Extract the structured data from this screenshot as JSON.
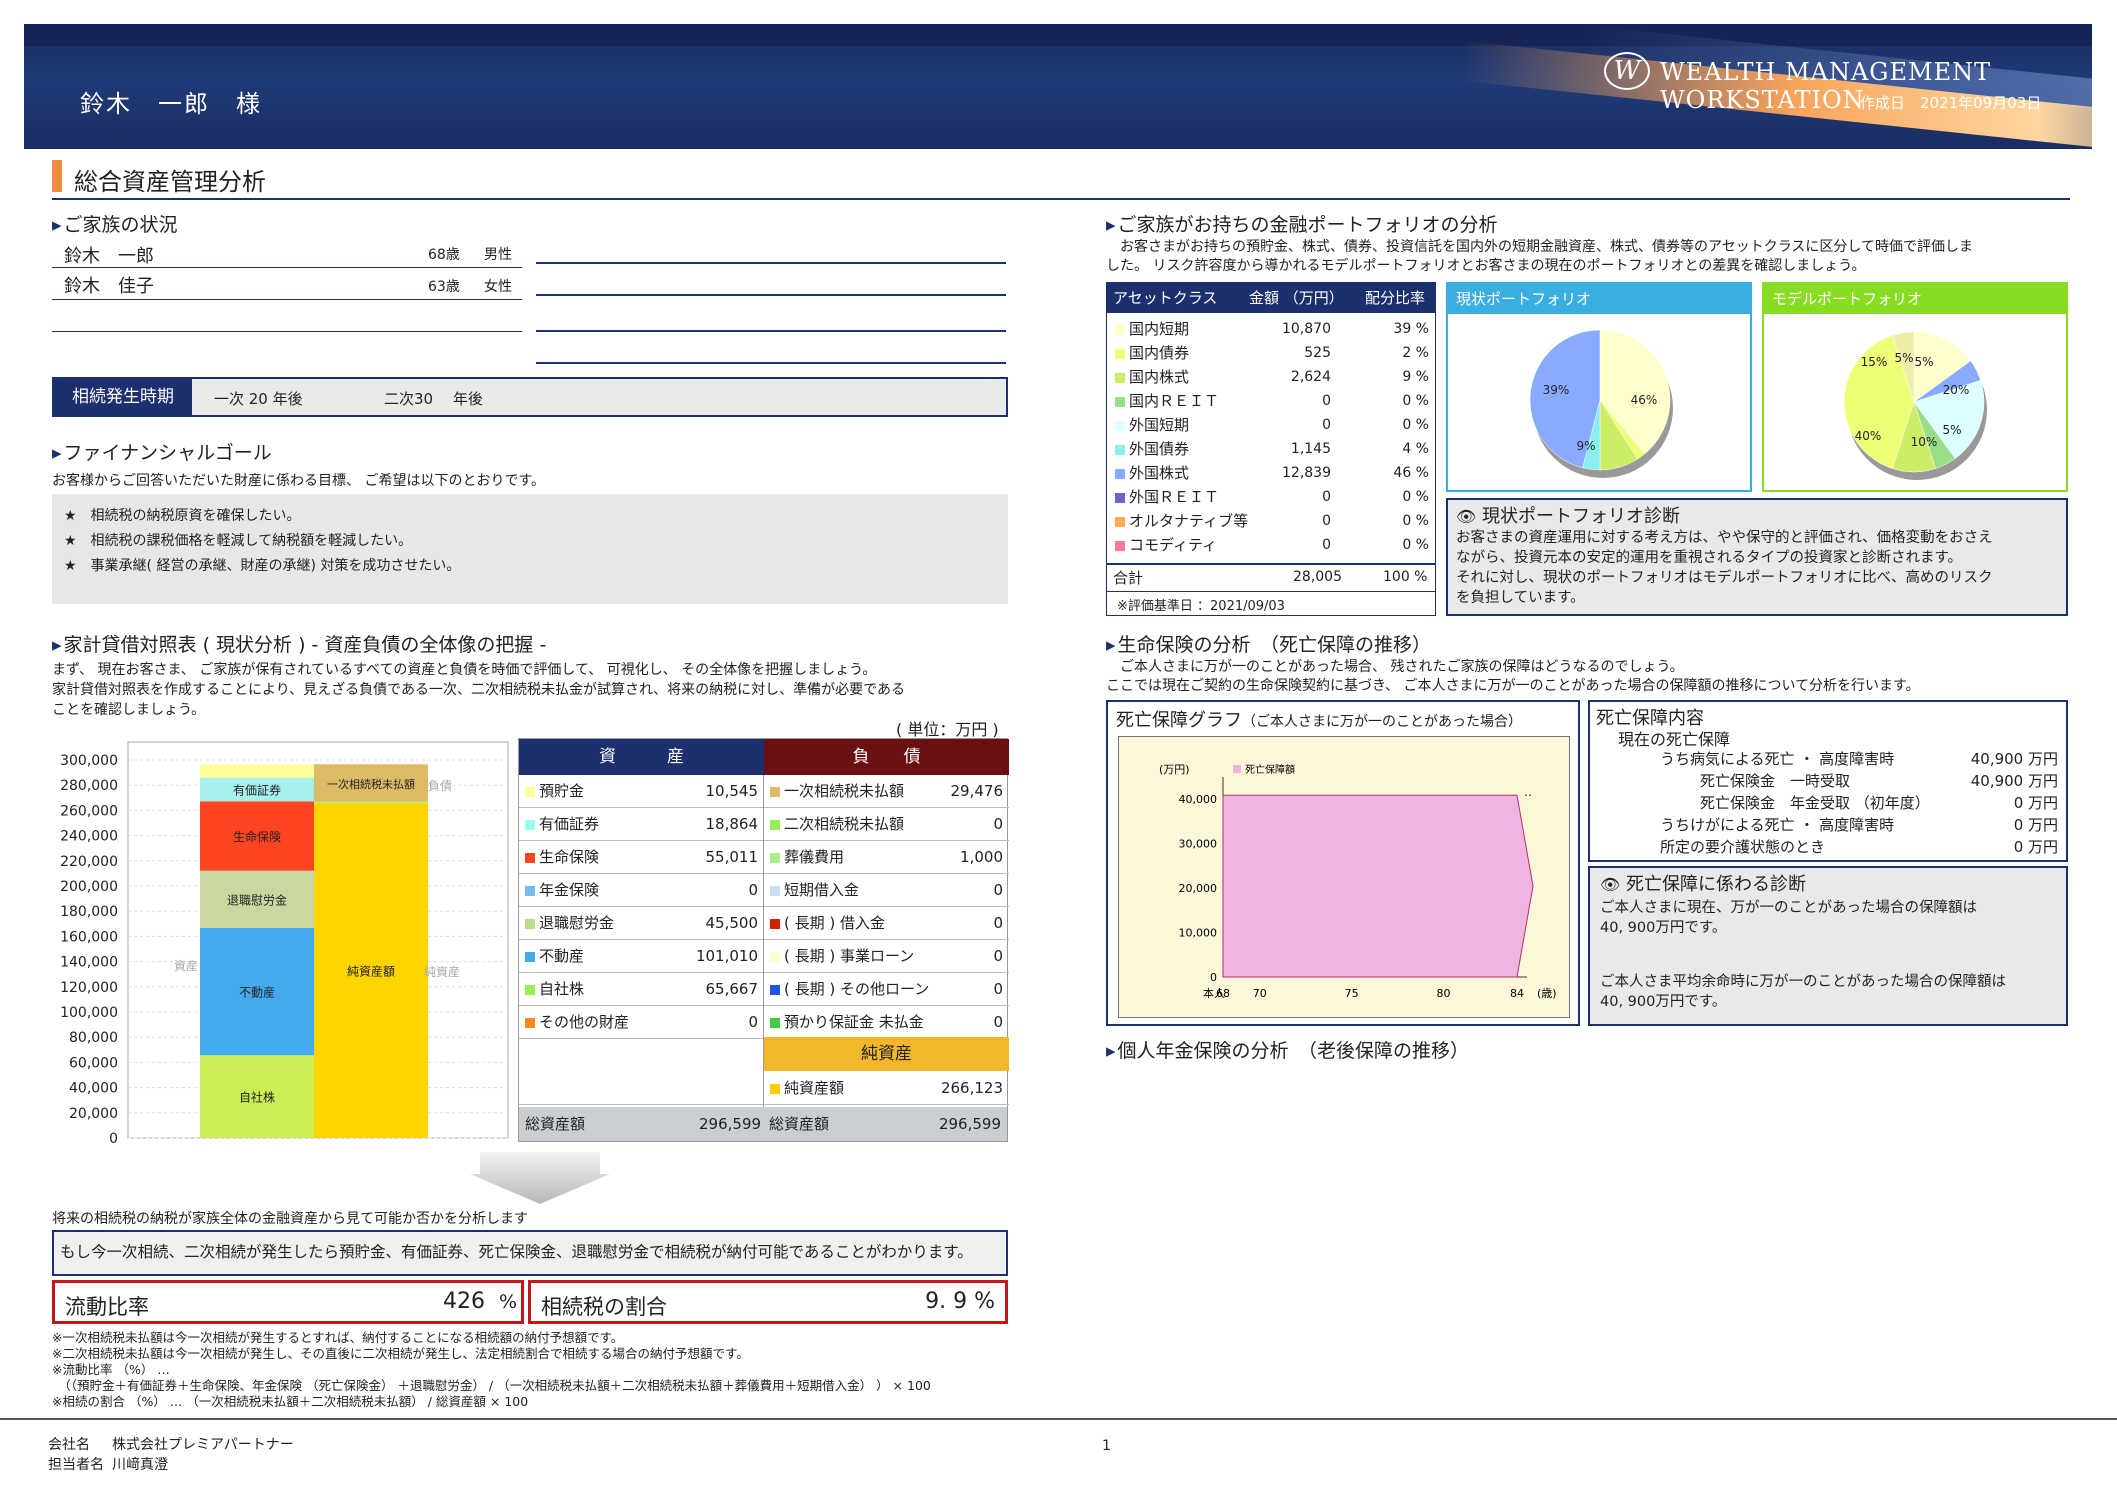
{
  "header": {
    "customer_name": "鈴木　一郎　様",
    "logo_letter": "W",
    "logo_text": "WEALTH MANAGEMENT WORKSTATION",
    "created_date": "作成日　2021年09月03日"
  },
  "page_title": "総合資産管理分析",
  "family": {
    "title": "ご家族の状況",
    "members": [
      {
        "name": "鈴木　一郎",
        "age": "68歳",
        "gender": "男性"
      },
      {
        "name": "鈴木　佳子",
        "age": "63歳",
        "gender": "女性"
      }
    ],
    "inheritance_label": "相続発生時期",
    "inheritance_first": "一次  20  年後",
    "inheritance_second": "二次30　 年後"
  },
  "goals": {
    "title": "ファイナンシャルゴール",
    "intro": "お客様からご回答いただいた財産に係わる目標、 ご希望は以下のとおりです。",
    "items": [
      "★　相続税の納税原資を確保したい。",
      "★　相続税の課税価格を軽減して納税額を軽減したい。",
      "★　事業承継( 経営の承継、財産の承継) 対策を成功させたい。"
    ]
  },
  "balance": {
    "title": "家計貸借対照表 ( 現状分析 )  - 資産負債の全体像の把握 -",
    "intro": "まず、 現在お客さま、 ご家族が保有されているすべての資産と負債を時価で評価して、 可視化し、 その全体像を把握しましょう。\n家計貸借対照表を作成することにより、見えざる負債である一次、二次相続税未払金が試算され、将来の納税に対し、準備が必要である\nことを確認しましょう。",
    "unit": "( 単位：万円 )",
    "assets_header": "資　　　産",
    "liab_header": "負　　債",
    "assets": [
      {
        "label": "預貯金",
        "value": "10,545",
        "color": "#ffff99"
      },
      {
        "label": "有価証券",
        "value": "18,864",
        "color": "#99ffee"
      },
      {
        "label": "生命保険",
        "value": "55,011",
        "color": "#ff4422"
      },
      {
        "label": "年金保険",
        "value": "0",
        "color": "#77bbee"
      },
      {
        "label": "退職慰労金",
        "value": "45,500",
        "color": "#bbdd88"
      },
      {
        "label": "不動産",
        "value": "101,010",
        "color": "#44aaee"
      },
      {
        "label": "自社株",
        "value": "65,667",
        "color": "#99ee55"
      },
      {
        "label": "その他の財産",
        "value": "0",
        "color": "#ff8822"
      }
    ],
    "liabilities": [
      {
        "label": "一次相続税未払額",
        "value": "29,476",
        "color": "#ddbb66"
      },
      {
        "label": "二次相続税未払額",
        "value": "0",
        "color": "#99ee55"
      },
      {
        "label": "葬儀費用",
        "value": "1,000",
        "color": "#aaee88"
      },
      {
        "label": "短期借入金",
        "value": "0",
        "color": "#ccddee"
      },
      {
        "label": "( 長期 ) 借入金",
        "value": "0",
        "color": "#cc2200"
      },
      {
        "label": "( 長期 ) 事業ローン",
        "value": "0",
        "color": "#ffffcc"
      },
      {
        "label": "( 長期 ) その他ローン",
        "value": "0",
        "color": "#2255dd"
      },
      {
        "label": "預かり保証金 未払金",
        "value": "0",
        "color": "#44cc44"
      }
    ],
    "net_header": "純資産",
    "net_label": "純資産額",
    "net_value": "266,123",
    "net_color": "#ffcc00",
    "total_label": "総資産額",
    "total_value": "296,599",
    "total_label2": "総資産額",
    "total_value2": "296,599"
  },
  "chart_data": [
    {
      "type": "bar",
      "title": "",
      "y_ticks": [
        "300,000",
        "280,000",
        "260,000",
        "240,000",
        "220,000",
        "200,000",
        "180,000",
        "160,000",
        "140,000",
        "120,000",
        "100,000",
        "80,000",
        "60,000",
        "40,000",
        "20,000",
        "0"
      ],
      "ylim": [
        0,
        300000
      ],
      "series": [
        {
          "name": "自社株",
          "stack": "資産",
          "value": 65667,
          "color": "#ccee55"
        },
        {
          "name": "不動産",
          "stack": "資産",
          "value": 101010,
          "color": "#44aaee"
        },
        {
          "name": "退職慰労金",
          "stack": "資産",
          "value": 45500,
          "color": "#c8d8a0"
        },
        {
          "name": "生命保険",
          "stack": "資産",
          "value": 55011,
          "color": "#ff4422"
        },
        {
          "name": "有価証券",
          "stack": "資産",
          "value": 18864,
          "color": "#a8f0ee"
        },
        {
          "name": "預貯金",
          "stack": "資産",
          "value": 10545,
          "color": "#ffff99"
        },
        {
          "name": "純資産額",
          "stack": "負債・純資産",
          "value": 266123,
          "color": "#ffd400"
        },
        {
          "name": "葬儀費用",
          "stack": "負債・純資産",
          "value": 1000,
          "color": "#aaee88"
        },
        {
          "name": "一次相続税未払額",
          "stack": "負債・純資産",
          "value": 29476,
          "color": "#ddbb66"
        }
      ],
      "side_labels": [
        "資産",
        "負債",
        "純資産"
      ]
    },
    {
      "type": "pie",
      "title": "現状ポートフォリオ",
      "values": [
        39,
        2,
        9,
        0,
        0,
        4,
        46,
        0,
        0,
        0
      ],
      "labels": [
        "39%",
        "9%",
        "46%"
      ]
    },
    {
      "type": "pie",
      "title": "モデルポートフォリオ",
      "values": [
        15,
        5,
        20,
        5,
        10,
        40,
        5
      ],
      "labels": [
        "15%",
        "5%",
        "5%",
        "20%",
        "5%",
        "10%",
        "40%"
      ]
    },
    {
      "type": "area",
      "title": "死亡保障グラフ",
      "subtitle": "（ご本人さまに万が一のことがあった場合）",
      "unit": "(万円)",
      "legend": "死亡保障額",
      "x": [
        68,
        70,
        75,
        80,
        84
      ],
      "x_ticks": [
        "68",
        "70",
        "75",
        "80",
        "84"
      ],
      "x_prefix": "本人",
      "x_suffix": "(歳)",
      "y_ticks": [
        "40,000",
        "30,000",
        "20,000",
        "10,000",
        "0"
      ],
      "ylim": [
        0,
        45000
      ],
      "series": [
        {
          "name": "死亡保障額",
          "values": [
            40900,
            40900,
            40900,
            40900,
            40900
          ]
        }
      ]
    }
  ],
  "arrow_text": "将来の相続税の納税が家族全体の金融資産から見て可能か否かを分析します",
  "conclusion": "もし今一次相続、二次相続が発生したら預貯金、有価証券、死亡保険金、退職慰労金で相続税が納付可能であることがわかります。",
  "ratios": {
    "liquidity_label": "流動比率",
    "liquidity_value": "426",
    "liquidity_unit": "%",
    "tax_label": "相続税の割合",
    "tax_value": "9. 9 %"
  },
  "notes": [
    "※一次相続税未払額は今一次相続が発生するとすれば、納付することになる相続額の納付予想額です。",
    "※二次相続税未払額は今一次相続が発生し、その直後に二次相続が発生し、法定相続割合で相続する場合の納付予想額です。",
    "※流動比率 （%） …",
    "　（（預貯金＋有価証券＋生命保険、年金保険 （死亡保険金） ＋退職慰労金） / （一次相続税未払額＋二次相続税未払額＋葬儀費用＋短期借入金） ） × 100",
    "※相続の割合 （%） … （一次相続税未払額＋二次相続税未払額） / 総資産額 × 100"
  ],
  "footer": {
    "company_label": "会社名",
    "company": "株式会社プレミアパートナー",
    "person_label": "担当者名",
    "person": "川﨑真澄",
    "page": "1"
  },
  "portfolio": {
    "title": "ご家族がお持ちの金融ポートフォリオの分析",
    "intro": "お客さまがお持ちの預貯金、株式、債券、投資信託を国内外の短期金融資産、株式、債券等のアセットクラスに区分して時価で評価しま\nした。 リスク許容度から導かれるモデルポートフォリオとお客さまの現在のポートフォリオとの差異を確認しましょう。",
    "headers": [
      "アセットクラス",
      "金額 （万円）",
      "配分比率"
    ],
    "rows": [
      {
        "name": "国内短期",
        "amount": "10,870",
        "pct": "39 %",
        "color": "#ffffcc"
      },
      {
        "name": "国内債券",
        "amount": "525",
        "pct": "2 %",
        "color": "#eeff77"
      },
      {
        "name": "国内株式",
        "amount": "2,624",
        "pct": "9 %",
        "color": "#ccee66"
      },
      {
        "name": "国内ＲＥＩＴ",
        "amount": "0",
        "pct": "0 %",
        "color": "#99dd88"
      },
      {
        "name": "外国短期",
        "amount": "0",
        "pct": "0 %",
        "color": "#ddffff"
      },
      {
        "name": "外国債券",
        "amount": "1,145",
        "pct": "4 %",
        "color": "#88eeee"
      },
      {
        "name": "外国株式",
        "amount": "12,839",
        "pct": "46 %",
        "color": "#88aaff"
      },
      {
        "name": "外国ＲＥＩＴ",
        "amount": "0",
        "pct": "0 %",
        "color": "#6666cc"
      },
      {
        "name": "オルタナティブ等",
        "amount": "0",
        "pct": "0 %",
        "color": "#ffaa55"
      },
      {
        "name": "コモディティ",
        "amount": "0",
        "pct": "0 %",
        "color": "#ff7799"
      }
    ],
    "total_label": "合計",
    "total_amount": "28,005",
    "total_pct": "100 %",
    "eval_date": "※評価基準日 ：2021/09/03",
    "current_title": "現状ポートフォリオ",
    "model_title": "モデルポートフォリオ",
    "diag_title": "現状ポートフォリオ診断",
    "diag_text": "お客さまの資産運用に対する考え方は、やや保守的と評価され、価格変動をおさえ\nながら、投資元本の安定的運用を重視されるタイプの投資家と診断されます。\nそれに対し、現状のポートフォリオはモデルポートフォリオに比べ、高めのリスク\nを負担しています。"
  },
  "life": {
    "title": "生命保険の分析　（死亡保障の推移）",
    "intro": "ご本人さまに万が一のことがあった場合、 残されたご家族の保障はどうなるのでしょう。\nここでは現在ご契約の生命保険契約に基づき、 ご本人さまに万が一のことがあった場合の保障額の推移について分析を行います。",
    "content_title": "死亡保障内容",
    "content_sub": "現在の死亡保障",
    "items": [
      {
        "label": "うち病気による死亡 ・ 高度障害時",
        "value": "40,900 万円"
      },
      {
        "label": "死亡保険金　一時受取",
        "value": "40,900 万円"
      },
      {
        "label": "死亡保険金　年金受取 （初年度）",
        "value": "0 万円"
      },
      {
        "label": "うちけがによる死亡 ・ 高度障害時",
        "value": "0 万円"
      },
      {
        "label": "所定の要介護状態のとき",
        "value": "0 万円"
      }
    ],
    "diag_title": "死亡保障に係わる診断",
    "diag_text1": "ご本人さまに現在、万が一のことがあった場合の保障額は\n40, 900万円です。",
    "diag_text2": "ご本人さま平均余命時に万が一のことがあった場合の保障額は\n40, 900万円です。"
  },
  "pension_title": "個人年金保険の分析　（老後保障の推移）"
}
